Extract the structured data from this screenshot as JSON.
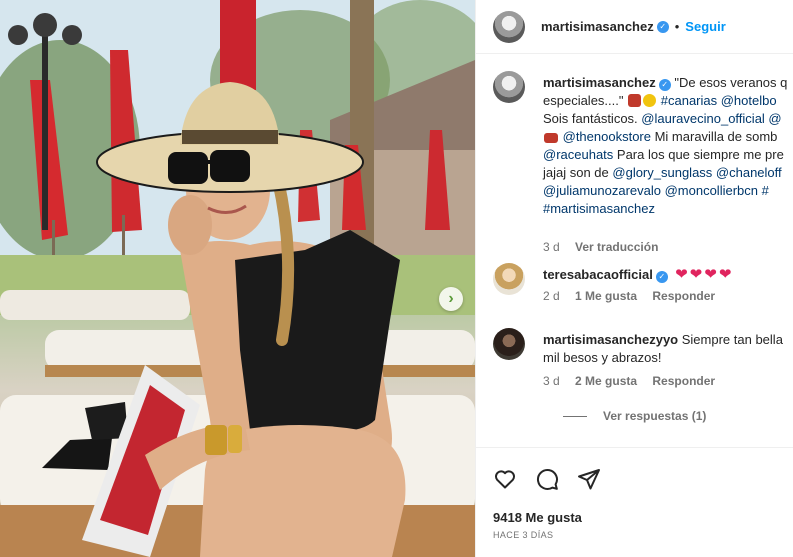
{
  "post": {
    "author": "martisimasanchez",
    "follow_label": "Seguir",
    "dot": "•"
  },
  "caption": {
    "author": "martisimasanchez",
    "line1_quote": "\"De esos veranos q",
    "line2_a": "especiales....\"",
    "line2_b": "#canarias @hotelbo",
    "line3_a": "Sois fantásticos. ",
    "line3_b": "@lauravecino_official @",
    "line4_a": "@thenookstore",
    "line4_b": " Mi maravilla de somb",
    "line5_a": "@raceuhats",
    "line5_b": " Para los que siempre me pre",
    "line6_a": "jajaj son de ",
    "line6_b": "@glory_sunglass @chaneloff",
    "line7": "@juliamunozarevalo @moncollierbcn #",
    "line8": "#martisimasanchez",
    "time": "3 d",
    "translate": "Ver traducción"
  },
  "comments": [
    {
      "author": "teresabacaofficial",
      "text": "",
      "hearts": [
        "❤",
        "❤",
        "❤",
        "❤"
      ],
      "time": "2 d",
      "likes": "1 Me gusta",
      "reply": "Responder"
    },
    {
      "author": "martisimasanchezyyo",
      "text_line1": "Siempre tan bella",
      "text_line2": "mil besos y abrazos!",
      "time": "3 d",
      "likes": "2 Me gusta",
      "reply": "Responder",
      "view_replies": "Ver respuestas (1)"
    }
  ],
  "actions": {
    "likes": "9418 Me gusta",
    "ago": "HACE 3 DÍAS"
  },
  "colors": {
    "link": "#00376b",
    "follow": "#0095f6",
    "verified": "#3897f0",
    "heart": "#e0245e",
    "muted": "#737373"
  }
}
